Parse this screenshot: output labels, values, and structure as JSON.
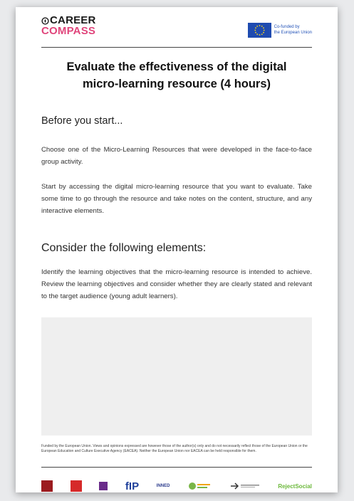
{
  "logo": {
    "line1": "CAREER",
    "line2": "COMPASS",
    "brand_color": "#e0457b"
  },
  "eu": {
    "line1": "Co-funded by",
    "line2": "the European Union",
    "flag_color": "#1f4bb0"
  },
  "title": {
    "line1": "Evaluate the effectiveness of the digital",
    "line2": "micro-learning resource (4 hours)"
  },
  "section1": {
    "heading": "Before you start...",
    "p1": "Choose one of the Micro-Learning Resources that were developed in the face-to-face group activity.",
    "p2": "Start by accessing the digital micro-learning resource that you want to evaluate. Take some time to go through the resource and take notes on the content, structure, and any interactive elements."
  },
  "section2": {
    "heading": "Consider the following elements:",
    "p1": "Identify the learning objectives that the micro-learning resource is intended to achieve. Review the learning objectives and consider whether they are clearly stated and relevant to the target audience (young adult learners)."
  },
  "footnote": "Funded by the European Union. Views and opinions expressed are however those of the author(s) only and do not necessarily reflect those of the European Union or the European Education and Culture Executive Agency (EACEA). Neither the European Union nor EACEA can be held responsible for them.",
  "partners": [
    {
      "name": "partner-logo-1",
      "color": "#9b1b1f",
      "text": ""
    },
    {
      "name": "partner-logo-2",
      "color": "#d62a2a",
      "text": ""
    },
    {
      "name": "partner-logo-3",
      "color": "#6a2b8a",
      "text": ""
    },
    {
      "name": "partner-logo-4",
      "color": "#1e3f9a",
      "text": "fIP"
    },
    {
      "name": "partner-logo-5",
      "color": "#2a3a8c",
      "text": "INNED"
    },
    {
      "name": "partner-logo-6",
      "color": "#7ab648",
      "text": ""
    },
    {
      "name": "partner-logo-7",
      "color": "#333333",
      "text": ""
    },
    {
      "name": "partner-logo-8",
      "color": "#6bb83a",
      "text": "RejectSocial"
    }
  ]
}
